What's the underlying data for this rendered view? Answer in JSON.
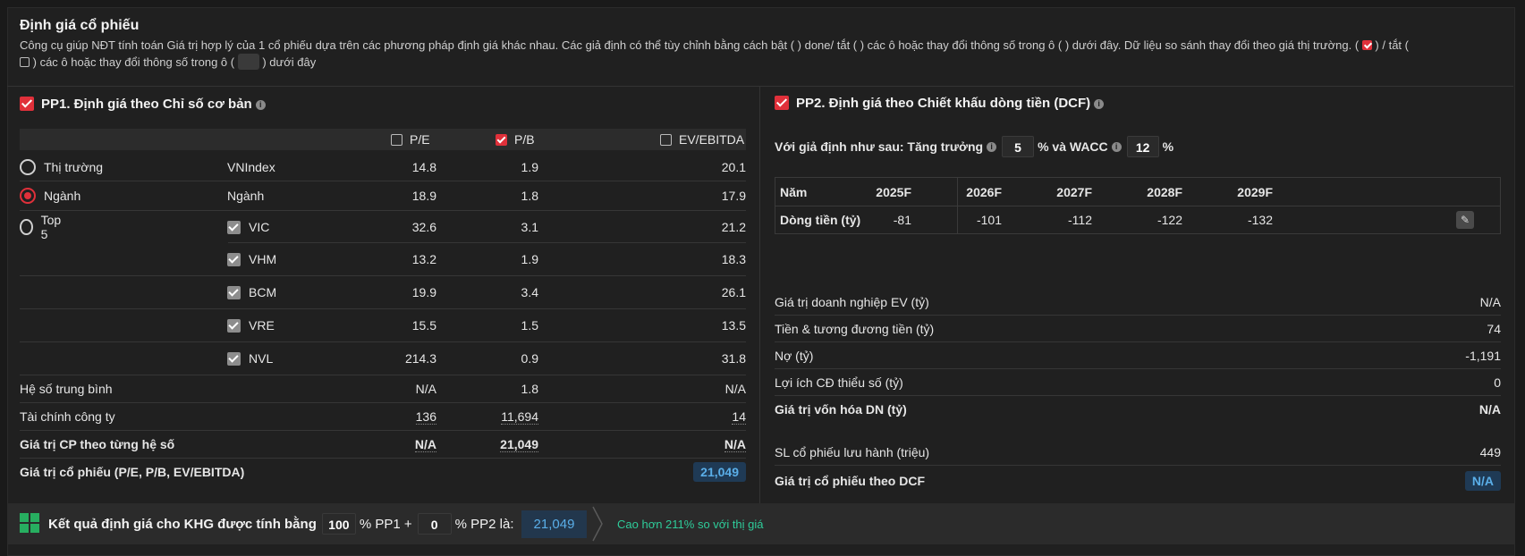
{
  "header": {
    "title": "Định giá cổ phiếu",
    "desc_part1": "Công cụ giúp NĐT tính toán Giá trị hợp lý của 1 cổ phiếu dựa trên các phương pháp định giá khác nhau. Các giả định có thể tùy chỉnh bằng cách bật ( ) done/ tắt ( ) các ô hoặc thay đổi thông số trong ô ( ) dưới đây. Dữ liệu so sánh thay đổi theo giá thị trường. (",
    "desc_part2": ") / tắt (",
    "desc_part3": ") các ô hoặc thay đổi thông số trong ô (",
    "desc_part4": ") dưới đây"
  },
  "pp1": {
    "title": "PP1. Định giá theo Chỉ số cơ bản",
    "headers": [
      "P/E",
      "P/B",
      "EV/EBITDA"
    ],
    "headers_checked": [
      false,
      true,
      false
    ],
    "rows": [
      {
        "label": "Thị trường",
        "radio": "off",
        "name": "VNIndex",
        "pe": "14.8",
        "pb": "1.9",
        "ev": "20.1"
      },
      {
        "label": "Ngành",
        "radio": "on",
        "name": "Ngành",
        "pe": "18.9",
        "pb": "1.8",
        "ev": "17.9"
      },
      {
        "label": "Top 5",
        "radio": "off",
        "name": "VIC",
        "pe": "32.6",
        "pb": "3.1",
        "ev": "21.2"
      },
      {
        "label": "",
        "name": "VHM",
        "pe": "13.2",
        "pb": "1.9",
        "ev": "18.3"
      },
      {
        "label": "",
        "name": "BCM",
        "pe": "19.9",
        "pb": "3.4",
        "ev": "26.1"
      },
      {
        "label": "",
        "name": "VRE",
        "pe": "15.5",
        "pb": "1.5",
        "ev": "13.5"
      },
      {
        "label": "",
        "name": "NVL",
        "pe": "214.3",
        "pb": "0.9",
        "ev": "31.8"
      }
    ],
    "avg": {
      "label": "Hệ số trung bình",
      "pe": "N/A",
      "pb": "1.8",
      "ev": "N/A"
    },
    "fin": {
      "label": "Tài chính công ty",
      "pe": "136",
      "pb": "11,694",
      "ev": "14"
    },
    "price": {
      "label": "Giá trị CP theo từng hệ số",
      "pe": "N/A",
      "pb": "21,049",
      "ev": "N/A"
    },
    "value": {
      "label": "Giá trị cổ phiếu (P/E, P/B, EV/EBITDA)",
      "amount": "21,049"
    }
  },
  "pp2": {
    "title": "PP2. Định giá theo Chiết khấu dòng tiền (DCF)",
    "assume_label": "Với giả định như sau: Tăng trưởng",
    "growth": "5",
    "mid_label": "% và WACC",
    "wacc": "12",
    "pct": "%",
    "table_headers": [
      "Năm",
      "2025F",
      "2026F",
      "2027F",
      "2028F",
      "2029F"
    ],
    "cashflow_label": "Dòng tiền (tỷ)",
    "cashflow": [
      "-81",
      "-101",
      "-112",
      "-122",
      "-132"
    ],
    "items": [
      {
        "label": "Giá trị doanh nghiệp EV (tỷ)",
        "value": "N/A"
      },
      {
        "label": "Tiền & tương đương tiền (tỷ)",
        "value": "74"
      },
      {
        "label": "Nợ (tỷ)",
        "value": "-1,191"
      },
      {
        "label": "Lợi ích CĐ thiểu số (tỷ)",
        "value": "0"
      },
      {
        "label": "Giá trị vốn hóa DN (tỷ)",
        "value": "N/A"
      },
      {
        "label": "SL cổ phiếu lưu hành (triệu)",
        "value": "449"
      },
      {
        "label": "Giá trị cổ phiếu theo DCF",
        "value": "N/A"
      }
    ]
  },
  "footer": {
    "label": "Kết quả định giá cho KHG được tính bằng",
    "pp1_pct": "100",
    "pp1_suffix": "% PP1 +",
    "pp2_pct": "0",
    "pp2_suffix": "% PP2 là:",
    "result": "21,049",
    "note": "Cao hơn 211% so với thị giá"
  },
  "colors": {
    "accent_red": "#e0303a",
    "result_blue": "#5aaee8",
    "note_green": "#2ecc9a",
    "background": "#202020"
  }
}
